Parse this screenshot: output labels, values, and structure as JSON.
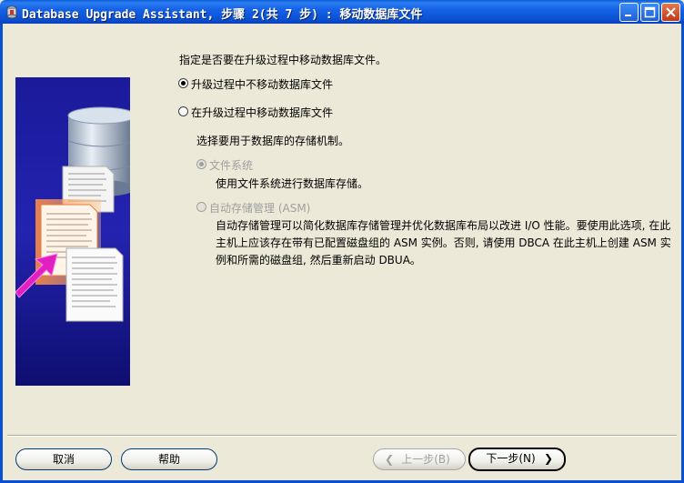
{
  "window": {
    "title": "Database Upgrade Assistant, 步骤 2(共 7 步) : 移动数据库文件"
  },
  "prompt": "指定是否要在升级过程中移动数据库文件。",
  "options": {
    "no_move": {
      "label": "升级过程中不移动数据库文件",
      "checked": true
    },
    "move": {
      "label": "在升级过程中移动数据库文件",
      "checked": false
    }
  },
  "storage": {
    "prompt": "选择要用于数据库的存储机制。",
    "fs": {
      "label": "文件系统",
      "desc": "使用文件系统进行数据库存储。",
      "checked": true,
      "enabled": false
    },
    "asm": {
      "label": "自动存储管理 (ASM)",
      "desc": "自动存储管理可以简化数据库存储管理并优化数据库布局以改进 I/O 性能。要使用此选项, 在此主机上应该存在带有已配置磁盘组的 ASM 实例。否则, 请使用 DBCA 在此主机上创建 ASM 实例和所需的磁盘组, 然后重新启动 DBUA。",
      "checked": false,
      "enabled": false
    }
  },
  "buttons": {
    "cancel": "取消",
    "help": "帮助",
    "back": "上一步(B)",
    "next": "下一步(N)"
  },
  "icons": [
    "app-icon",
    "minimize-icon",
    "maximize-icon",
    "close-icon",
    "database-cylinder-icon",
    "documents-icon",
    "arrow-left-icon",
    "arrow-right-icon"
  ]
}
